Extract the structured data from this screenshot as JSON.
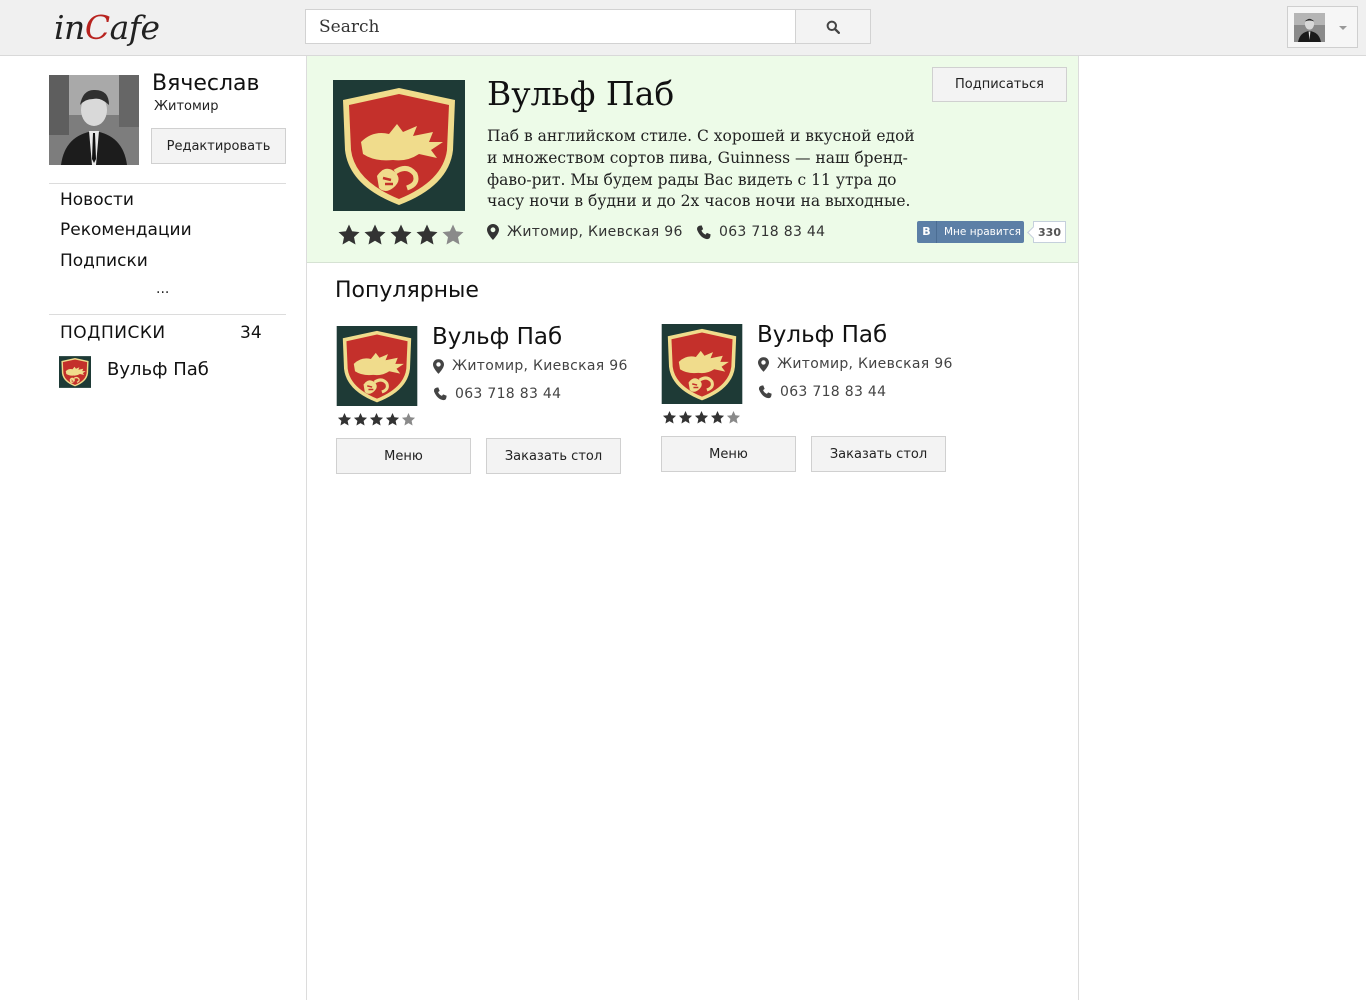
{
  "app": {
    "logo_pre": "in",
    "logo_c": "C",
    "logo_post": "afe"
  },
  "search": {
    "placeholder": "Search",
    "button_icon": "search-icon"
  },
  "user_menu": {
    "icon": "chevron-down-icon"
  },
  "profile": {
    "name": "Вячеслав",
    "city": "Житомир",
    "edit_label": "Редактировать"
  },
  "nav": {
    "items": [
      {
        "label": "Новости"
      },
      {
        "label": "Рекомендации"
      },
      {
        "label": "Подписки"
      }
    ],
    "more": "..."
  },
  "subscriptions": {
    "title": "ПОДПИСКИ",
    "count": "34",
    "items": [
      {
        "name": "Вульф Паб"
      }
    ]
  },
  "cafe": {
    "name": "Вульф Паб",
    "description": "Паб в английском стиле. С хорошей и вкусной едой и множеством сортов пива, Guinness — наш бренд-фаво-рит. Мы будем рады Вас видеть с 11 утра до часу ночи в будни и до 2х часов ночи на выходные.",
    "address": "Житомир, Киевская 96",
    "phone": "063 718 83 44",
    "rating": 4,
    "rating_max": 5,
    "subscribe_label": "Подписаться",
    "like": {
      "logo": "В",
      "label": "Мне нравится",
      "count": "330"
    }
  },
  "popular": {
    "title": "Популярные",
    "items": [
      {
        "name": "Вульф Паб",
        "address": "Житомир, Киевская 96",
        "phone": "063 718 83 44",
        "rating": 4,
        "menu_label": "Меню",
        "order_label": "Заказать стол"
      },
      {
        "name": "Вульф Паб",
        "address": "Житомир, Киевская 96",
        "phone": "063 718 83 44",
        "rating": 4,
        "menu_label": "Меню",
        "order_label": "Заказать стол"
      }
    ]
  },
  "colors": {
    "accent": "#b8231f",
    "header_bg": "#edfbe8",
    "logo_bg": "#1e3a36",
    "logo_shield": "#c4302b",
    "logo_gold": "#f0dc8c",
    "vk_blue": "#5c7fa6"
  }
}
